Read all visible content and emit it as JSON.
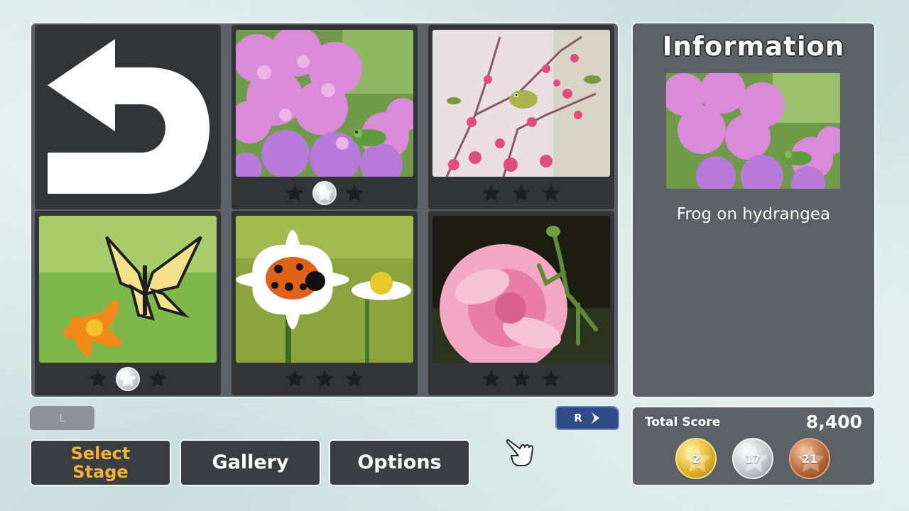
{
  "grid": {
    "back_tile": {
      "icon": "back-arrow-icon"
    },
    "stages": [
      {
        "name": "hydrangea-frog",
        "stars": [
          "dark",
          "silver",
          "dark"
        ]
      },
      {
        "name": "plum-white-eye",
        "stars": [
          "dark",
          "dark",
          "dark"
        ]
      },
      {
        "name": "swallowtail-butterfly",
        "stars": [
          "dark",
          "silver",
          "dark"
        ]
      },
      {
        "name": "ladybug-daisy",
        "stars": [
          "dark",
          "dark",
          "dark"
        ]
      },
      {
        "name": "mantis-rose",
        "stars": [
          "dark",
          "dark",
          "dark"
        ]
      }
    ]
  },
  "info": {
    "title": "Information",
    "caption": "Frog on hydrangea"
  },
  "score": {
    "label": "Total Score",
    "value": "8,400",
    "medals": {
      "gold": "2",
      "silver": "17",
      "bronze": "21"
    }
  },
  "nav": {
    "l_button": "L",
    "r_button": "R",
    "select_stage_line1": "Select",
    "select_stage_line2": "Stage",
    "gallery": "Gallery",
    "options": "Options"
  },
  "colors": {
    "panel": "#5c6168",
    "tile": "#323438",
    "active_text": "#f3b232",
    "r_button": "#2e4a87"
  }
}
